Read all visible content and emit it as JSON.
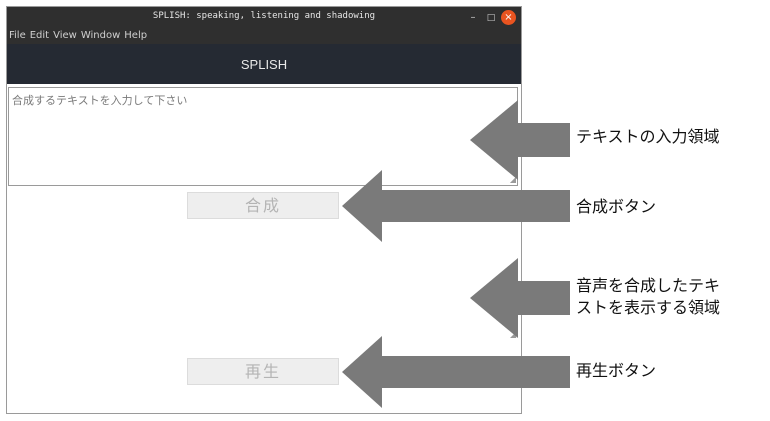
{
  "window": {
    "title": "SPLISH: speaking, listening and shadowing",
    "controls": {
      "minimize": "–",
      "maximize": "□",
      "close": "×"
    }
  },
  "menu": [
    "File",
    "Edit",
    "View",
    "Window",
    "Help"
  ],
  "header": {
    "title": "SPLISH"
  },
  "text_input": {
    "placeholder": "合成するテキストを入力して下さい"
  },
  "buttons": {
    "synthesize": "合成",
    "play": "再生"
  },
  "annotations": {
    "input_area": "テキストの入力領域",
    "synth_button": "合成ボタン",
    "output_area_line1": "音声を合成したテキ",
    "output_area_line2": "ストを表示する領域",
    "play_button": "再生ボタン"
  },
  "colors": {
    "titlebar": "#2f2f2f",
    "header": "#252a33",
    "close_button": "#e95420",
    "arrow": "#7a7a7a"
  }
}
